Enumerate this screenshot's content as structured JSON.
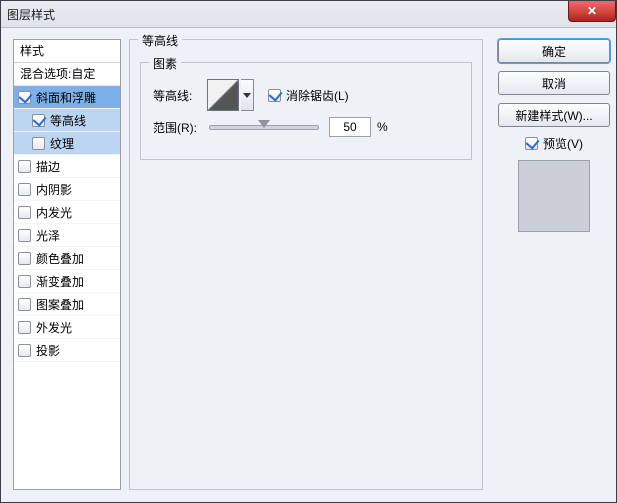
{
  "window": {
    "title": "图层样式"
  },
  "styles": {
    "header": "样式",
    "blend": "混合选项:自定",
    "items": [
      {
        "label": "斜面和浮雕",
        "checked": true,
        "indent": false,
        "sel": "active"
      },
      {
        "label": "等高线",
        "checked": true,
        "indent": true,
        "sel": "sub"
      },
      {
        "label": "纹理",
        "checked": false,
        "indent": true,
        "sel": "sub"
      },
      {
        "label": "描边",
        "checked": false,
        "indent": false,
        "sel": ""
      },
      {
        "label": "内阴影",
        "checked": false,
        "indent": false,
        "sel": ""
      },
      {
        "label": "内发光",
        "checked": false,
        "indent": false,
        "sel": ""
      },
      {
        "label": "光泽",
        "checked": false,
        "indent": false,
        "sel": ""
      },
      {
        "label": "颜色叠加",
        "checked": false,
        "indent": false,
        "sel": ""
      },
      {
        "label": "渐变叠加",
        "checked": false,
        "indent": false,
        "sel": ""
      },
      {
        "label": "图案叠加",
        "checked": false,
        "indent": false,
        "sel": ""
      },
      {
        "label": "外发光",
        "checked": false,
        "indent": false,
        "sel": ""
      },
      {
        "label": "投影",
        "checked": false,
        "indent": false,
        "sel": ""
      }
    ]
  },
  "settings": {
    "outer_legend": "等高线",
    "inner_legend": "图素",
    "contour_label": "等高线:",
    "antialias_label": "消除锯齿(L)",
    "antialias_checked": true,
    "range_label": "范围(R):",
    "range_value": "50",
    "range_unit": "%"
  },
  "buttons": {
    "ok": "确定",
    "cancel": "取消",
    "new_style": "新建样式(W)...",
    "preview_label": "预览(V)",
    "preview_checked": true
  }
}
